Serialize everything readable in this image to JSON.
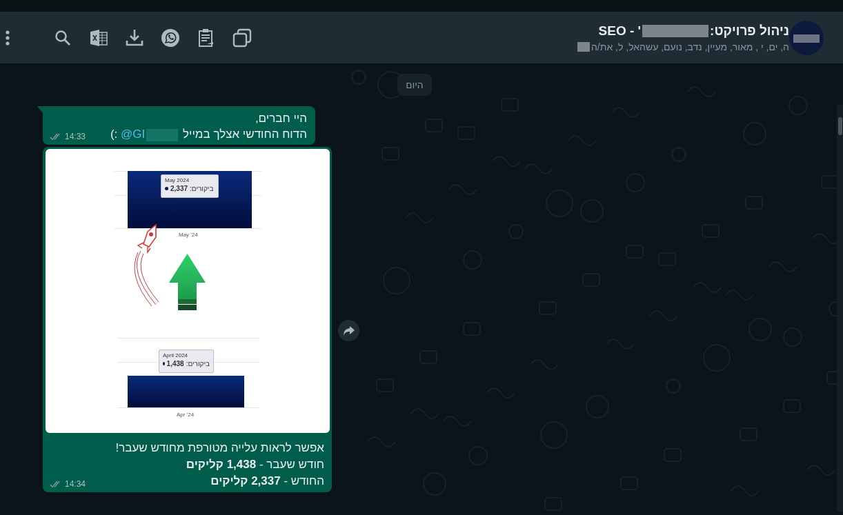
{
  "header": {
    "title_start": "ניהול פרויקט:",
    "title_end": "' - SEO",
    "members": "ה, ים, י , מאור, מעיין, נדב, נועם, עשהאל, ל, את/ה"
  },
  "date_chip": "היום",
  "messages": [
    {
      "kind": "text",
      "greeting": "היי חברים,",
      "body": "הדוח החודשי אצלך במייל",
      "mention": "@GI",
      "emoticon": ":)",
      "time": "14:33",
      "read": false
    },
    {
      "kind": "image",
      "image": {
        "top_month": "May 2024",
        "top_metric": "ביקורים:",
        "top_value": "2,337",
        "top_axis": "May '24",
        "bottom_month": "April 2024",
        "bottom_metric": "ביקורים:",
        "bottom_value": "1,438",
        "bottom_axis": "Apr '24"
      },
      "caption": [
        "אפשר לראות עלייה מטורפת מחודש שעבר!",
        "חודש שעבר - **1,438 קליקים**",
        "החודש - **2,337 קליקים**"
      ],
      "time": "14:34",
      "read": false
    }
  ]
}
